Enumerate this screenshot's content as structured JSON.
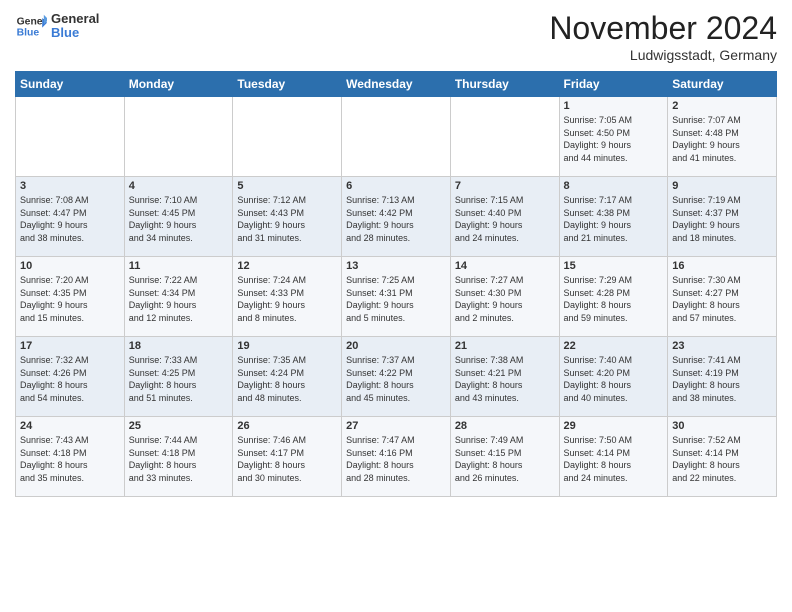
{
  "header": {
    "logo_general": "General",
    "logo_blue": "Blue",
    "month_title": "November 2024",
    "location": "Ludwigsstadt, Germany"
  },
  "weekdays": [
    "Sunday",
    "Monday",
    "Tuesday",
    "Wednesday",
    "Thursday",
    "Friday",
    "Saturday"
  ],
  "weeks": [
    [
      {
        "day": "",
        "info": ""
      },
      {
        "day": "",
        "info": ""
      },
      {
        "day": "",
        "info": ""
      },
      {
        "day": "",
        "info": ""
      },
      {
        "day": "",
        "info": ""
      },
      {
        "day": "1",
        "info": "Sunrise: 7:05 AM\nSunset: 4:50 PM\nDaylight: 9 hours\nand 44 minutes."
      },
      {
        "day": "2",
        "info": "Sunrise: 7:07 AM\nSunset: 4:48 PM\nDaylight: 9 hours\nand 41 minutes."
      }
    ],
    [
      {
        "day": "3",
        "info": "Sunrise: 7:08 AM\nSunset: 4:47 PM\nDaylight: 9 hours\nand 38 minutes."
      },
      {
        "day": "4",
        "info": "Sunrise: 7:10 AM\nSunset: 4:45 PM\nDaylight: 9 hours\nand 34 minutes."
      },
      {
        "day": "5",
        "info": "Sunrise: 7:12 AM\nSunset: 4:43 PM\nDaylight: 9 hours\nand 31 minutes."
      },
      {
        "day": "6",
        "info": "Sunrise: 7:13 AM\nSunset: 4:42 PM\nDaylight: 9 hours\nand 28 minutes."
      },
      {
        "day": "7",
        "info": "Sunrise: 7:15 AM\nSunset: 4:40 PM\nDaylight: 9 hours\nand 24 minutes."
      },
      {
        "day": "8",
        "info": "Sunrise: 7:17 AM\nSunset: 4:38 PM\nDaylight: 9 hours\nand 21 minutes."
      },
      {
        "day": "9",
        "info": "Sunrise: 7:19 AM\nSunset: 4:37 PM\nDaylight: 9 hours\nand 18 minutes."
      }
    ],
    [
      {
        "day": "10",
        "info": "Sunrise: 7:20 AM\nSunset: 4:35 PM\nDaylight: 9 hours\nand 15 minutes."
      },
      {
        "day": "11",
        "info": "Sunrise: 7:22 AM\nSunset: 4:34 PM\nDaylight: 9 hours\nand 12 minutes."
      },
      {
        "day": "12",
        "info": "Sunrise: 7:24 AM\nSunset: 4:33 PM\nDaylight: 9 hours\nand 8 minutes."
      },
      {
        "day": "13",
        "info": "Sunrise: 7:25 AM\nSunset: 4:31 PM\nDaylight: 9 hours\nand 5 minutes."
      },
      {
        "day": "14",
        "info": "Sunrise: 7:27 AM\nSunset: 4:30 PM\nDaylight: 9 hours\nand 2 minutes."
      },
      {
        "day": "15",
        "info": "Sunrise: 7:29 AM\nSunset: 4:28 PM\nDaylight: 8 hours\nand 59 minutes."
      },
      {
        "day": "16",
        "info": "Sunrise: 7:30 AM\nSunset: 4:27 PM\nDaylight: 8 hours\nand 57 minutes."
      }
    ],
    [
      {
        "day": "17",
        "info": "Sunrise: 7:32 AM\nSunset: 4:26 PM\nDaylight: 8 hours\nand 54 minutes."
      },
      {
        "day": "18",
        "info": "Sunrise: 7:33 AM\nSunset: 4:25 PM\nDaylight: 8 hours\nand 51 minutes."
      },
      {
        "day": "19",
        "info": "Sunrise: 7:35 AM\nSunset: 4:24 PM\nDaylight: 8 hours\nand 48 minutes."
      },
      {
        "day": "20",
        "info": "Sunrise: 7:37 AM\nSunset: 4:22 PM\nDaylight: 8 hours\nand 45 minutes."
      },
      {
        "day": "21",
        "info": "Sunrise: 7:38 AM\nSunset: 4:21 PM\nDaylight: 8 hours\nand 43 minutes."
      },
      {
        "day": "22",
        "info": "Sunrise: 7:40 AM\nSunset: 4:20 PM\nDaylight: 8 hours\nand 40 minutes."
      },
      {
        "day": "23",
        "info": "Sunrise: 7:41 AM\nSunset: 4:19 PM\nDaylight: 8 hours\nand 38 minutes."
      }
    ],
    [
      {
        "day": "24",
        "info": "Sunrise: 7:43 AM\nSunset: 4:18 PM\nDaylight: 8 hours\nand 35 minutes."
      },
      {
        "day": "25",
        "info": "Sunrise: 7:44 AM\nSunset: 4:18 PM\nDaylight: 8 hours\nand 33 minutes."
      },
      {
        "day": "26",
        "info": "Sunrise: 7:46 AM\nSunset: 4:17 PM\nDaylight: 8 hours\nand 30 minutes."
      },
      {
        "day": "27",
        "info": "Sunrise: 7:47 AM\nSunset: 4:16 PM\nDaylight: 8 hours\nand 28 minutes."
      },
      {
        "day": "28",
        "info": "Sunrise: 7:49 AM\nSunset: 4:15 PM\nDaylight: 8 hours\nand 26 minutes."
      },
      {
        "day": "29",
        "info": "Sunrise: 7:50 AM\nSunset: 4:14 PM\nDaylight: 8 hours\nand 24 minutes."
      },
      {
        "day": "30",
        "info": "Sunrise: 7:52 AM\nSunset: 4:14 PM\nDaylight: 8 hours\nand 22 minutes."
      }
    ]
  ]
}
